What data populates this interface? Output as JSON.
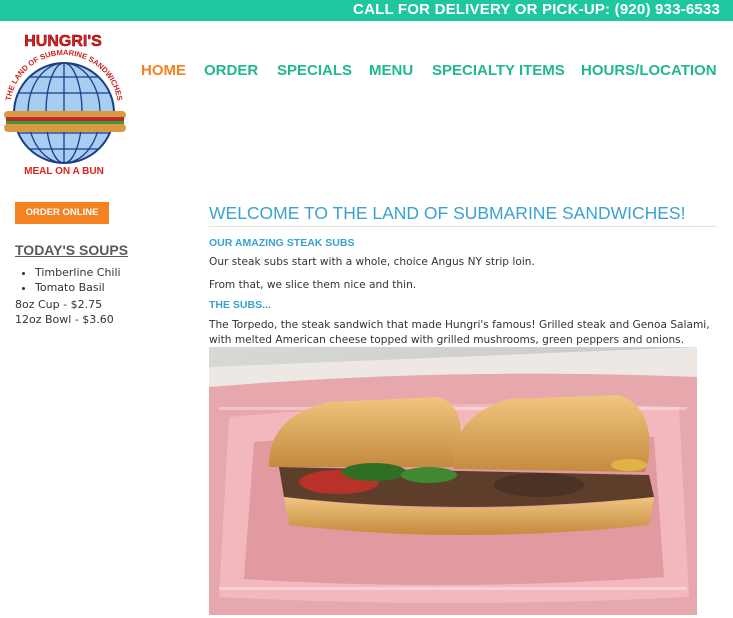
{
  "topbar": {
    "phone_text": "CALL FOR DELIVERY OR PICK-UP: (920) 933-6533"
  },
  "logo": {
    "brand": "HUNGRI'S",
    "tagline": "THE LAND OF SUBMARINE SANDWICHES",
    "slogan": "MEAL ON A BUN"
  },
  "nav": {
    "items": [
      {
        "label": "HOME",
        "active": true
      },
      {
        "label": "ORDER"
      },
      {
        "label": "SPECIALS"
      },
      {
        "label": "MENU"
      },
      {
        "label": "SPECIALTY ITEMS"
      },
      {
        "label": "HOURS/LOCATION"
      }
    ]
  },
  "sidebar": {
    "order_button": "ORDER ONLINE",
    "soups_title": "TODAY'S SOUPS",
    "soups": [
      "Timberline Chili",
      "Tomato Basil"
    ],
    "prices": [
      "8oz Cup - $2.75",
      "12oz Bowl - $3.60"
    ]
  },
  "main": {
    "title": "WELCOME TO THE LAND OF SUBMARINE SANDWICHES!",
    "section1_heading": "OUR AMAZING STEAK SUBS",
    "section1_p1": "Our steak subs start with a whole, choice Angus NY strip loin.",
    "section1_p2": "From that, we slice them nice and thin.",
    "section2_heading": "THE SUBS...",
    "section2_p1": "The Torpedo, the steak sandwich that made Hungri's famous! Grilled steak and Genoa Salami, with melted American cheese topped with grilled mushrooms, green peppers and onions."
  },
  "colors": {
    "accent": "#1fc7a0",
    "nav_text": "#1fb890",
    "active": "#f58220",
    "heading": "#3aa2d0"
  }
}
